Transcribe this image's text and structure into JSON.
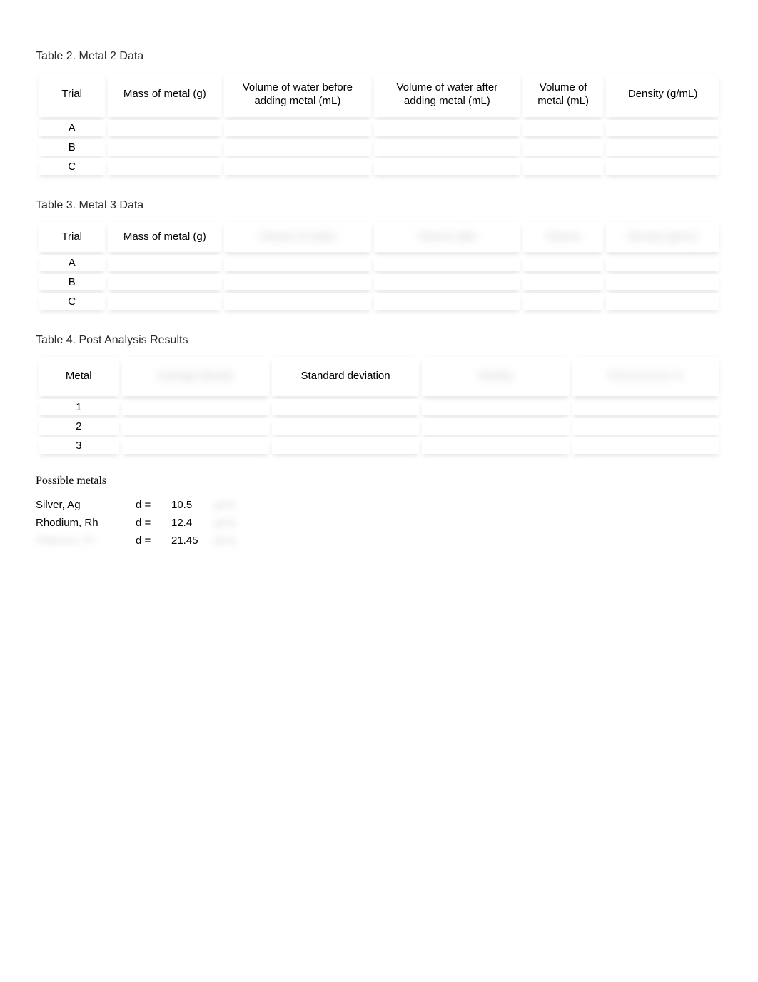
{
  "table2": {
    "title": "Table 2. Metal 2 Data",
    "headers": {
      "trial": "Trial",
      "mass": "Mass of metal (g)",
      "vol_before_l1": "Volume of water before",
      "vol_before_l2": "adding metal (mL)",
      "vol_after_l1": "Volume of water after",
      "vol_after_l2": "adding metal (mL)",
      "vol_metal_l1": "Volume of",
      "vol_metal_l2": "metal (mL)",
      "density": "Density (g/mL)"
    },
    "rows": [
      "A",
      "B",
      "C"
    ]
  },
  "table3": {
    "title": "Table 3. Metal 3 Data",
    "headers": {
      "trial": "Trial",
      "mass": "Mass of metal (g)",
      "h3_blur": "Volume of water",
      "h4_blur": "Volume after",
      "h5_blur": "Volume",
      "h6_blur": "Density (g/mL)"
    },
    "rows": [
      "A",
      "B",
      "C"
    ]
  },
  "table4": {
    "title": "Table 4. Post Analysis Results",
    "headers": {
      "metal": "Metal",
      "h2_blur": "Average density",
      "stddev": "Standard deviation",
      "h4_blur": "Identity",
      "h5_blur": "Percent error %"
    },
    "rows": [
      "1",
      "2",
      "3"
    ]
  },
  "possible": {
    "heading": "Possible metals",
    "eq": "d  =",
    "items": [
      {
        "name": "Silver, Ag",
        "value": "10.5",
        "unit_blur": "g/mL"
      },
      {
        "name": "Rhodium, Rh",
        "value": "12.4",
        "unit_blur": "g/mL"
      },
      {
        "name_blur": "Platinum, Pt",
        "value": "21.45",
        "unit_blur": "g/mL"
      }
    ]
  }
}
